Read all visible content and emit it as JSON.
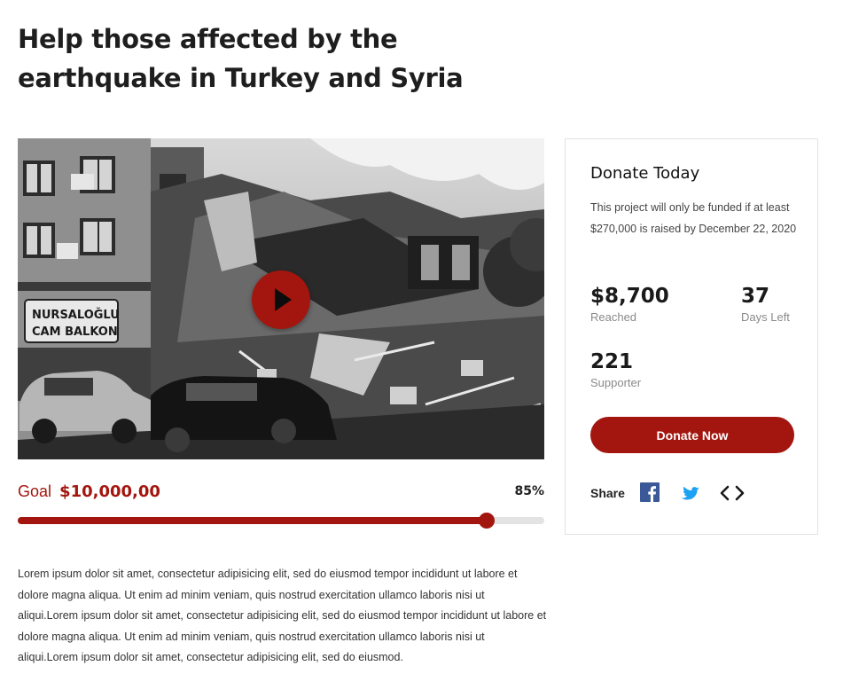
{
  "campaign": {
    "title": "Help those affected by the earthquake in Turkey and Syria",
    "media": {
      "play_icon": "play-icon",
      "photo_signage": [
        "NURSALOĞLU",
        "CAM BALKON"
      ]
    },
    "goal": {
      "label": "Goal",
      "amount": "$10,000,00",
      "percent_text": "85%",
      "progress": 0.89
    },
    "description": "Lorem ipsum dolor sit amet, consectetur adipisicing elit, sed do eiusmod tempor incididunt ut labore et dolore magna aliqua. Ut enim ad minim veniam, quis nostrud exercitation ullamco laboris nisi ut aliqui.Lorem ipsum dolor sit amet, consectetur adipisicing elit, sed do eiusmod tempor incididunt ut labore et dolore magna aliqua. Ut enim ad minim veniam, quis nostrud exercitation ullamco laboris nisi ut aliqui.Lorem ipsum dolor sit amet, consectetur adipisicing elit, sed do eiusmod."
  },
  "donate_card": {
    "title": "Donate Today",
    "note": "This project will only be funded if at least $270,000 is raised by December 22, 2020",
    "stats": {
      "reached": {
        "value": "$8,700",
        "label": "Reached"
      },
      "days_left": {
        "value": "37",
        "label": "Days Left"
      },
      "supporters": {
        "value": "221",
        "label": "Supporter"
      }
    },
    "donate_button": "Donate Now",
    "share": {
      "label": "Share",
      "icons": [
        "facebook-icon",
        "twitter-icon",
        "embed-code-icon"
      ]
    }
  },
  "colors": {
    "accent": "#a3160f",
    "track": "#e3e3e3",
    "facebook": "#3b5998",
    "twitter": "#1da1f2"
  }
}
